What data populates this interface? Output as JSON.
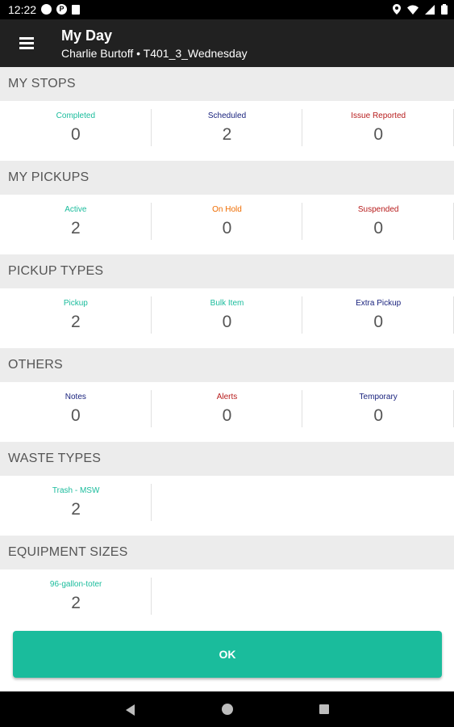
{
  "status_bar": {
    "time": "12:22",
    "left_icons": [
      "circle-icon",
      "p-icon",
      "sd-card-icon"
    ],
    "right_icons": [
      "location-icon",
      "wifi-icon",
      "signal-icon",
      "battery-icon"
    ]
  },
  "header": {
    "title": "My Day",
    "subtitle": "Charlie Burtoff • T401_3_Wednesday",
    "menu_icon": "hamburger-icon"
  },
  "sections": [
    {
      "title": "MY STOPS",
      "items": [
        {
          "label": "Completed",
          "value": "0",
          "color": "#1abc9c"
        },
        {
          "label": "Scheduled",
          "value": "2",
          "color": "#1a237e"
        },
        {
          "label": "Issue Reported",
          "value": "0",
          "color": "#b71c1c"
        }
      ]
    },
    {
      "title": "MY PICKUPS",
      "items": [
        {
          "label": "Active",
          "value": "2",
          "color": "#1abc9c"
        },
        {
          "label": "On Hold",
          "value": "0",
          "color": "#ef6c00"
        },
        {
          "label": "Suspended",
          "value": "0",
          "color": "#b71c1c"
        }
      ]
    },
    {
      "title": "PICKUP TYPES",
      "items": [
        {
          "label": "Pickup",
          "value": "2",
          "color": "#1abc9c"
        },
        {
          "label": "Bulk Item",
          "value": "0",
          "color": "#1abc9c"
        },
        {
          "label": "Extra Pickup",
          "value": "0",
          "color": "#1a237e"
        }
      ]
    },
    {
      "title": "OTHERS",
      "items": [
        {
          "label": "Notes",
          "value": "0",
          "color": "#1a237e"
        },
        {
          "label": "Alerts",
          "value": "0",
          "color": "#b71c1c"
        },
        {
          "label": "Temporary",
          "value": "0",
          "color": "#1a237e"
        }
      ]
    },
    {
      "title": "WASTE TYPES",
      "items": [
        {
          "label": "Trash - MSW",
          "value": "2",
          "color": "#1abc9c"
        }
      ]
    },
    {
      "title": "EQUIPMENT SIZES",
      "items": [
        {
          "label": "96-gallon-toter",
          "value": "2",
          "color": "#1abc9c"
        }
      ]
    }
  ],
  "ok_button": {
    "label": "OK",
    "color": "#1abc9c"
  },
  "nav_bar": {
    "icons": [
      "back-icon",
      "home-icon",
      "recents-icon"
    ]
  }
}
